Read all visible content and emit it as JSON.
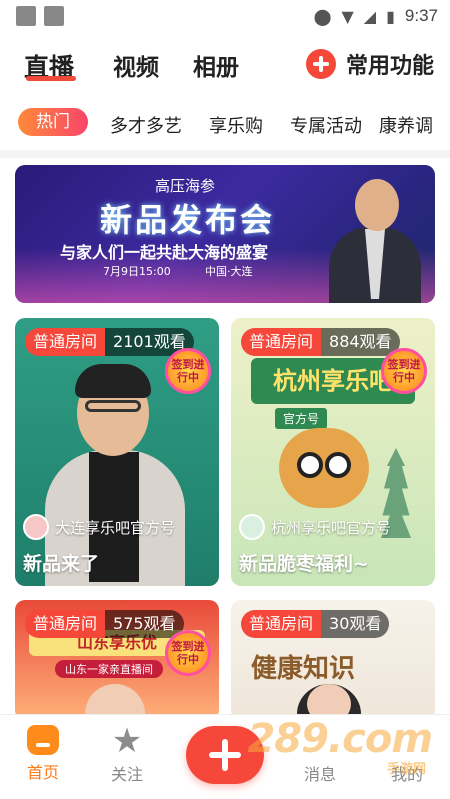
{
  "status_bar": {
    "time": "9:37"
  },
  "top_tabs": [
    {
      "label": "直播",
      "active": true
    },
    {
      "label": "视频",
      "active": false
    },
    {
      "label": "相册",
      "active": false
    }
  ],
  "common_functions_label": "常用功能",
  "categories": [
    {
      "label": "热门",
      "active": true
    },
    {
      "label": "多才多艺"
    },
    {
      "label": "享乐购"
    },
    {
      "label": "专属活动"
    },
    {
      "label": "康养调"
    }
  ],
  "banner": {
    "subtitle": "高压海参",
    "title": "新品发布会",
    "slogan": "与家人们一起共赴大海的盛宴",
    "date": "7月9日15:00",
    "location": "中国·大连"
  },
  "signin_label": "签到进行中",
  "cards": [
    {
      "type": "普通房间",
      "views": "2101观看",
      "anchor": "大连享乐吧官方号",
      "title": "新品来了"
    },
    {
      "type": "普通房间",
      "views": "884观看",
      "anchor": "杭州享乐吧官方号",
      "title": "新品脆枣福利~",
      "poster_title": "杭州享乐吧",
      "poster_tag": "官方号"
    },
    {
      "type": "普通房间",
      "views": "575观看",
      "poster_title": "山东享乐优",
      "poster_sub": "山东一家亲直播间"
    },
    {
      "type": "普通房间",
      "views": "30观看",
      "poster_title": "健康知识"
    }
  ],
  "bottom_nav": [
    {
      "label": "首页",
      "active": true
    },
    {
      "label": "关注"
    },
    {
      "label": "消息"
    },
    {
      "label": "我的"
    }
  ],
  "watermark": {
    "text": "289.com",
    "sub": "手游网"
  },
  "colors": {
    "accent": "#f5473a",
    "home_orange": "#ff8c1a"
  }
}
